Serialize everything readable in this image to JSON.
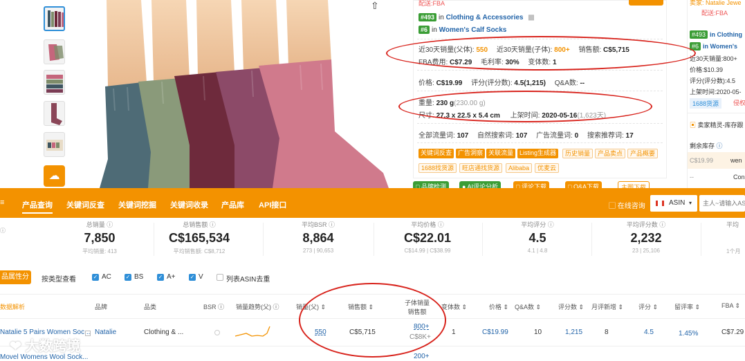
{
  "product": {
    "rank1": {
      "num": "#493",
      "cat": "Clothing & Accessories"
    },
    "rank2": {
      "num": "#6",
      "cat": "Women's Calf Socks"
    },
    "sales30_parent_label": "近30天销量(父体):",
    "sales30_parent": "550",
    "sales30_child_label": "近30天销量(子体):",
    "sales30_child": "800+",
    "revenue_label": "销售额:",
    "revenue": "C$5,715",
    "fba_label": "FBA费用:",
    "fba": "C$7.29",
    "margin_label": "毛利率:",
    "margin": "30%",
    "variants_label": "变体数:",
    "variants": "1",
    "price_label": "价格:",
    "price": "C$19.99",
    "rating_label": "评分(评分数):",
    "rating": "4.5(1,215)",
    "qa_label": "Q&A数:",
    "qa": "--",
    "weight_label": "重量:",
    "weight": "230 g",
    "weight_alt": "(230.00 g)",
    "size_label": "尺寸:",
    "size": "27.3 x 22.5 x 5.4 cm",
    "listed_label": "上架时间:",
    "listed": "2020-05-16",
    "listed_days": "(1,623天)",
    "kw_all_label": "全部流量词:",
    "kw_all": "107",
    "kw_natural_label": "自然搜索词:",
    "kw_natural": "107",
    "kw_ad_label": "广告流量词:",
    "kw_ad": "0",
    "kw_rec_label": "搜索推荐词:",
    "kw_rec": "17",
    "top_text": "配送:FBA"
  },
  "tags_row1": [
    "关键词反查",
    "广告洞察",
    "关联流量",
    "Listing生成器",
    "历史销量",
    "产品卖点",
    "产品概要"
  ],
  "tags_row2": [
    "1688找货源",
    "旺店通找货源",
    "Alibaba",
    "优麦云"
  ],
  "green_buttons": [
    "品牌检测",
    "AI评论分析",
    "评论下载",
    "Q&A下载",
    "主图下载"
  ],
  "right_panel": {
    "seller_top": "卖家: Natalie Jewe",
    "fba": "配送:FBA",
    "rank1": "#493",
    "rank1_cat": "in Clothing",
    "rank2": "#6",
    "rank2_cat": "in Women's",
    "sales": "近30天销量:800+",
    "price": "价格:$10.39",
    "rating": "评分(评分数):4.5",
    "listed": "上架时间:2020-05-",
    "btn1": "1688货源",
    "btn2": "侵权",
    "sprite": "卖家精灵-库存跟",
    "stock": "剩余库存",
    "price_cell": "C$19.99",
    "cell2": "wen",
    "dash": "--",
    "cell3": "Con"
  },
  "toolbar": {
    "items": [
      "产品查询",
      "关键词反查",
      "关键词挖掘",
      "关键词收录",
      "产品库",
      "API接口"
    ],
    "consult": "在线咨询",
    "country": "ASIN",
    "search_placeholder": "主人~请输入ASI"
  },
  "stats": [
    {
      "label": "总销量",
      "value": "7,850",
      "sub": "平均销量: 413"
    },
    {
      "label": "总销售额",
      "value": "C$165,534",
      "sub": "平均销售额: C$8,712"
    },
    {
      "label": "平均BSR",
      "value": "8,864",
      "sub": "273 | 90,653"
    },
    {
      "label": "平均价格",
      "value": "C$22.01",
      "sub": "C$14.99 | C$38.99"
    },
    {
      "label": "平均评分",
      "value": "4.5",
      "sub": "4.1 | 4.8"
    },
    {
      "label": "平均评分数",
      "value": "2,232",
      "sub": "23 | 25,106"
    },
    {
      "label": "平均",
      "value": "",
      "sub": "1个月"
    }
  ],
  "filters": {
    "tab_active": "品属性分析",
    "tab2": "按类型查看",
    "checks": [
      "AC",
      "BS",
      "A+",
      "V"
    ],
    "dedupe": "列表ASIN去重"
  },
  "table": {
    "headers": [
      "数据解析",
      "品牌",
      "品类",
      "BSR",
      "销量趋势(父)",
      "销量(父)",
      "销售额",
      "子体销量",
      "销售额",
      "变体数",
      "价格",
      "Q&A数",
      "评分数",
      "月评新增",
      "评分",
      "留评率",
      "FBA"
    ],
    "row1": {
      "title": "Natalie 5 Pairs Women Soc...",
      "brand": "Natalie",
      "category": "Clothing & ...",
      "sales_parent": "550",
      "revenue": "C$5,715",
      "child_sales": "800+",
      "child_revenue": "C$8K+",
      "variants": "1",
      "price": "C$19.99",
      "qa": "10",
      "reviews": "1,215",
      "monthly_new": "8",
      "rating": "4.5",
      "review_rate": "1.45%",
      "fba": "C$7.29"
    },
    "row2": {
      "title": "Movel Womens Wool Sock...",
      "child_sales": "200+"
    }
  },
  "watermark": "大数跨境"
}
